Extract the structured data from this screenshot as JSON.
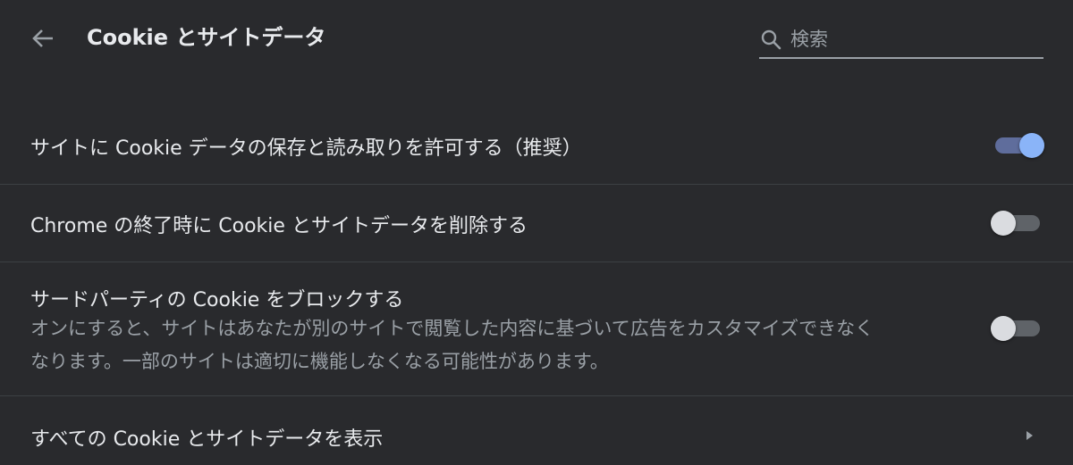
{
  "header": {
    "title": "Cookie とサイトデータ",
    "back_icon": "arrow-back-icon",
    "search": {
      "icon": "search-icon",
      "placeholder": "検索",
      "value": ""
    }
  },
  "settings": [
    {
      "label": "サイトに Cookie データの保存と読み取りを許可する（推奨）",
      "toggle_state": "on"
    },
    {
      "label": "Chrome の終了時に Cookie とサイトデータを削除する",
      "toggle_state": "off"
    },
    {
      "label": "サードパーティの Cookie をブロックする",
      "description_line1": "オンにすると、サイトはあなたが別のサイトで閲覧した内容に基づいて広告をカスタマイズできなく",
      "description_line2": "なります。一部のサイトは適切に機能しなくなる可能性があります。",
      "toggle_state": "off"
    }
  ],
  "link_row": {
    "label": "すべての Cookie とサイトデータを表示",
    "icon": "chevron-right-icon"
  },
  "colors": {
    "background": "#292a2d",
    "text_primary": "#e8eaed",
    "text_secondary": "#9aa0a6",
    "toggle_on_knob": "#8ab4f8",
    "toggle_on_track": "#5f6d9c",
    "toggle_off_knob": "#dadce0",
    "toggle_off_track": "#5f6368",
    "divider": "#3c4043"
  }
}
